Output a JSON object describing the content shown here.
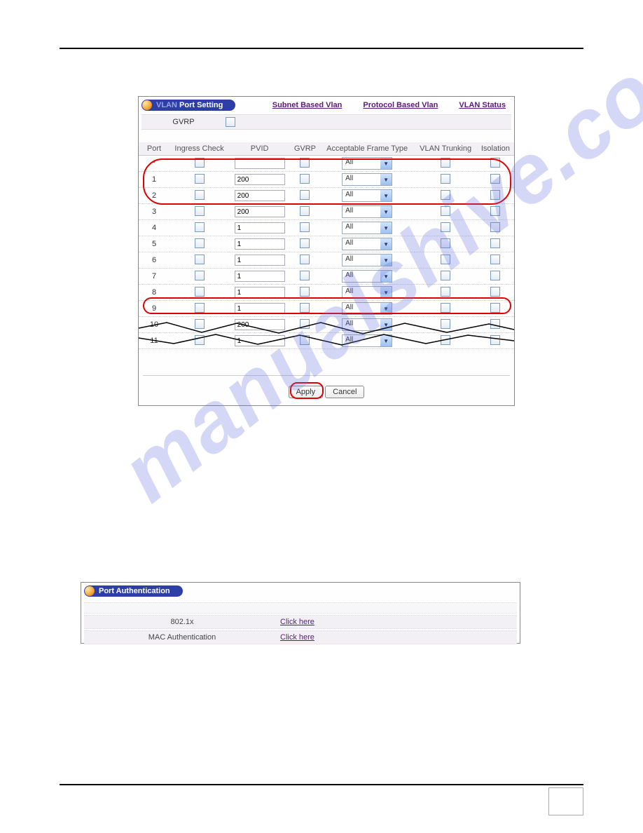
{
  "fig1": {
    "title_prefix": "VLAN",
    "title_suffix": " Port Setting",
    "links": {
      "subnet": "Subnet Based Vlan",
      "protocol": "Protocol Based Vlan",
      "status": "VLAN Status"
    },
    "gvrp_label": "GVRP",
    "headers": {
      "port": "Port",
      "ingress": "Ingress Check",
      "pvid": "PVID",
      "gvrp": "GVRP",
      "aft": "Acceptable Frame Type",
      "trunking": "VLAN Trunking",
      "isolation": "Isolation"
    },
    "aft_value": "All",
    "rows": [
      {
        "port": "*",
        "pvid": ""
      },
      {
        "port": "1",
        "pvid": "200"
      },
      {
        "port": "2",
        "pvid": "200"
      },
      {
        "port": "3",
        "pvid": "200"
      },
      {
        "port": "4",
        "pvid": "1"
      },
      {
        "port": "5",
        "pvid": "1"
      },
      {
        "port": "6",
        "pvid": "1"
      },
      {
        "port": "7",
        "pvid": "1"
      },
      {
        "port": "8",
        "pvid": "1"
      },
      {
        "port": "9",
        "pvid": "1"
      },
      {
        "port": "10",
        "pvid": "200"
      },
      {
        "port": "11",
        "pvid": "1"
      }
    ],
    "buttons": {
      "apply": "Apply",
      "cancel": "Cancel"
    }
  },
  "fig2": {
    "title": "Port Authentication",
    "rows": [
      {
        "label": "802.1x",
        "link": "Click here"
      },
      {
        "label": "MAC Authentication",
        "link": "Click here"
      }
    ]
  }
}
